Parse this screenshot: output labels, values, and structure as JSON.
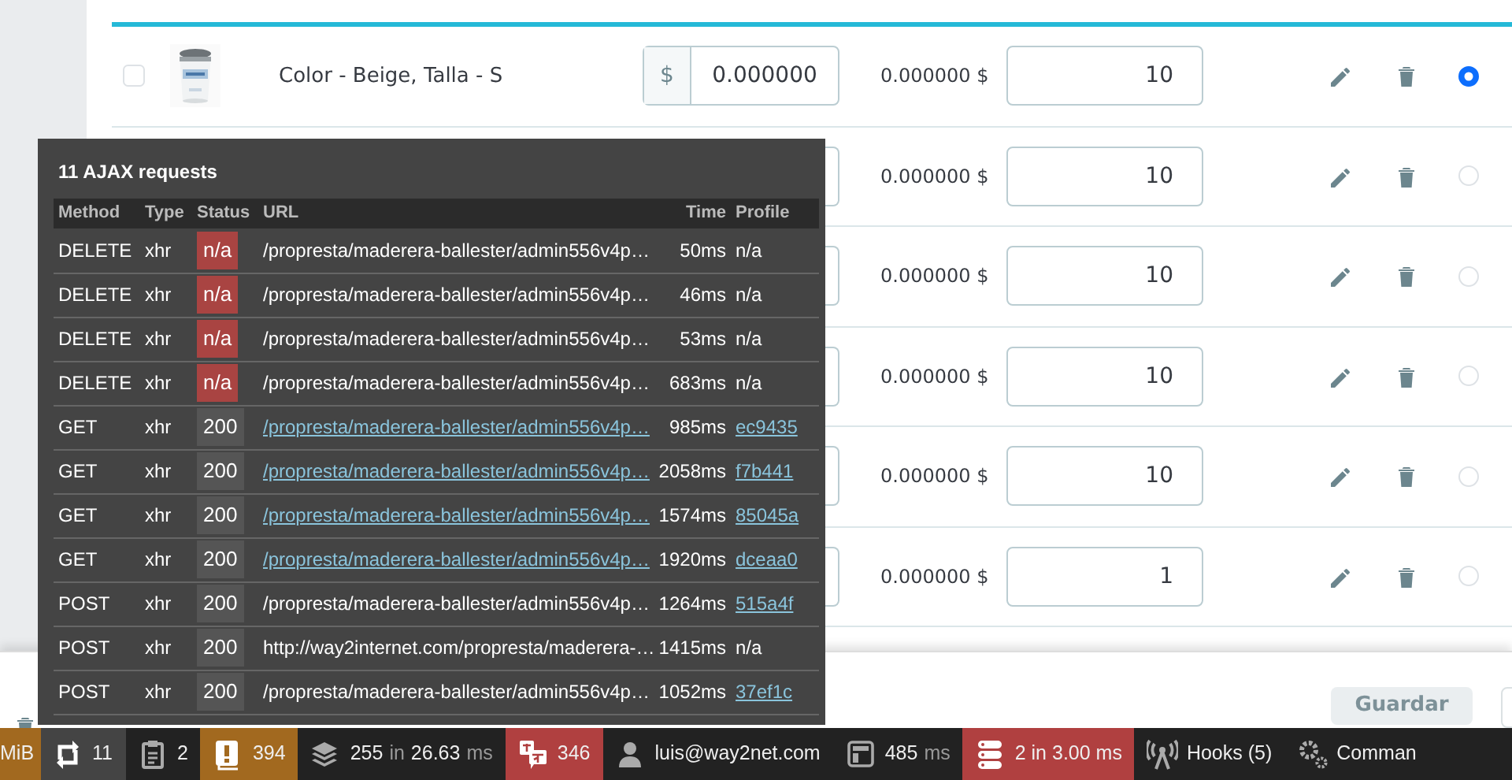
{
  "product_rows": [
    {
      "checked": false,
      "name": "Color - Beige, Talla - S",
      "currency": "$",
      "price_value": "0.000000",
      "price": "0.000000 $",
      "quantity": "10",
      "selected": true
    },
    {
      "price": "0.000000 $",
      "quantity": "10",
      "selected": false
    },
    {
      "price": "0.000000 $",
      "quantity": "10",
      "selected": false
    },
    {
      "price": "0.000000 $",
      "quantity": "10",
      "selected": false
    },
    {
      "price": "0.000000 $",
      "quantity": "10",
      "selected": false
    },
    {
      "price": "0.000000 $",
      "quantity": "1",
      "selected": false
    }
  ],
  "footer": {
    "save_button": {
      "label": "Guardar",
      "disabled": true
    }
  },
  "ajax_panel": {
    "title": "11 AJAX requests",
    "columns": [
      "Method",
      "Type",
      "Status",
      "URL",
      "Time",
      "Profile"
    ],
    "requests": [
      {
        "method": "DELETE",
        "type": "xhr",
        "status": "n/a",
        "color": "#a94442",
        "url": "/propresta/maderera-ballester/admin556v4p…",
        "url_link": false,
        "time": "50ms",
        "profile": "n/a",
        "profile_link": false
      },
      {
        "method": "DELETE",
        "type": "xhr",
        "status": "n/a",
        "color": "#a94442",
        "url": "/propresta/maderera-ballester/admin556v4p…",
        "url_link": false,
        "time": "46ms",
        "profile": "n/a",
        "profile_link": false
      },
      {
        "method": "DELETE",
        "type": "xhr",
        "status": "n/a",
        "color": "#a94442",
        "url": "/propresta/maderera-ballester/admin556v4p…",
        "url_link": false,
        "time": "53ms",
        "profile": "n/a",
        "profile_link": false
      },
      {
        "method": "DELETE",
        "type": "xhr",
        "status": "n/a",
        "color": "#a94442",
        "url": "/propresta/maderera-ballester/admin556v4p…",
        "url_link": false,
        "time": "683ms",
        "profile": "n/a",
        "profile_link": false
      },
      {
        "method": "GET",
        "type": "xhr",
        "status": "200",
        "color": "#555555",
        "url": "/propresta/maderera-ballester/admin556v4p…",
        "url_link": true,
        "time": "985ms",
        "profile": "ec9435",
        "profile_link": true
      },
      {
        "method": "GET",
        "type": "xhr",
        "status": "200",
        "color": "#555555",
        "url": "/propresta/maderera-ballester/admin556v4p…",
        "url_link": true,
        "time": "2058ms",
        "profile": "f7b441",
        "profile_link": true
      },
      {
        "method": "GET",
        "type": "xhr",
        "status": "200",
        "color": "#555555",
        "url": "/propresta/maderera-ballester/admin556v4p…",
        "url_link": true,
        "time": "1574ms",
        "profile": "85045a",
        "profile_link": true
      },
      {
        "method": "GET",
        "type": "xhr",
        "status": "200",
        "color": "#555555",
        "url": "/propresta/maderera-ballester/admin556v4p…",
        "url_link": true,
        "time": "1920ms",
        "profile": "dceaa0",
        "profile_link": true
      },
      {
        "method": "POST",
        "type": "xhr",
        "status": "200",
        "color": "#555555",
        "url": "/propresta/maderera-ballester/admin556v4p…",
        "url_link": false,
        "time": "1264ms",
        "profile": "515a4f",
        "profile_link": true
      },
      {
        "method": "POST",
        "type": "xhr",
        "status": "200",
        "color": "#555555",
        "url": "http://way2internet.com/propresta/maderera-…",
        "url_link": false,
        "time": "1415ms",
        "profile": "n/a",
        "profile_link": false
      },
      {
        "method": "POST",
        "type": "xhr",
        "status": "200",
        "color": "#555555",
        "url": "/propresta/maderera-ballester/admin556v4p…",
        "url_link": false,
        "time": "1052ms",
        "profile": "37ef1c",
        "profile_link": true
      }
    ]
  },
  "toolbar": [
    {
      "kind": "memory",
      "color": "#a2691f",
      "segments": [
        {
          "text": "MiB",
          "muted": false
        }
      ]
    },
    {
      "kind": "ajax",
      "color": "#444444",
      "segments": [
        {
          "text": "11",
          "muted": false
        }
      ]
    },
    {
      "kind": "logs",
      "color": "#222222",
      "segments": [
        {
          "text": "2",
          "muted": false
        }
      ]
    },
    {
      "kind": "warnings",
      "color": "#a2691f",
      "segments": [
        {
          "text": "394",
          "muted": false
        }
      ]
    },
    {
      "kind": "templates",
      "color": "#222222",
      "segments": [
        {
          "text": "255",
          "muted": false
        },
        {
          "text": "in",
          "muted": true
        },
        {
          "text": "26.63",
          "muted": false
        },
        {
          "text": "ms",
          "muted": true
        }
      ]
    },
    {
      "kind": "translations",
      "color": "#b04040",
      "segments": [
        {
          "text": "346",
          "muted": false
        }
      ]
    },
    {
      "kind": "user",
      "color": "#222222",
      "segments": [
        {
          "text": "luis@way2net.com",
          "muted": false
        }
      ]
    },
    {
      "kind": "time",
      "color": "#222222",
      "segments": [
        {
          "text": "485",
          "muted": false
        },
        {
          "text": "ms",
          "muted": true
        }
      ]
    },
    {
      "kind": "database",
      "color": "#b04040",
      "segments": [
        {
          "text": "2 in 3.00 ms",
          "muted": false
        }
      ]
    },
    {
      "kind": "hooks",
      "color": "#222222",
      "segments": [
        {
          "text": "Hooks (5)",
          "muted": false
        }
      ]
    },
    {
      "kind": "commands",
      "color": "#222222",
      "segments": [
        {
          "text": "Comman",
          "muted": false
        }
      ]
    }
  ]
}
